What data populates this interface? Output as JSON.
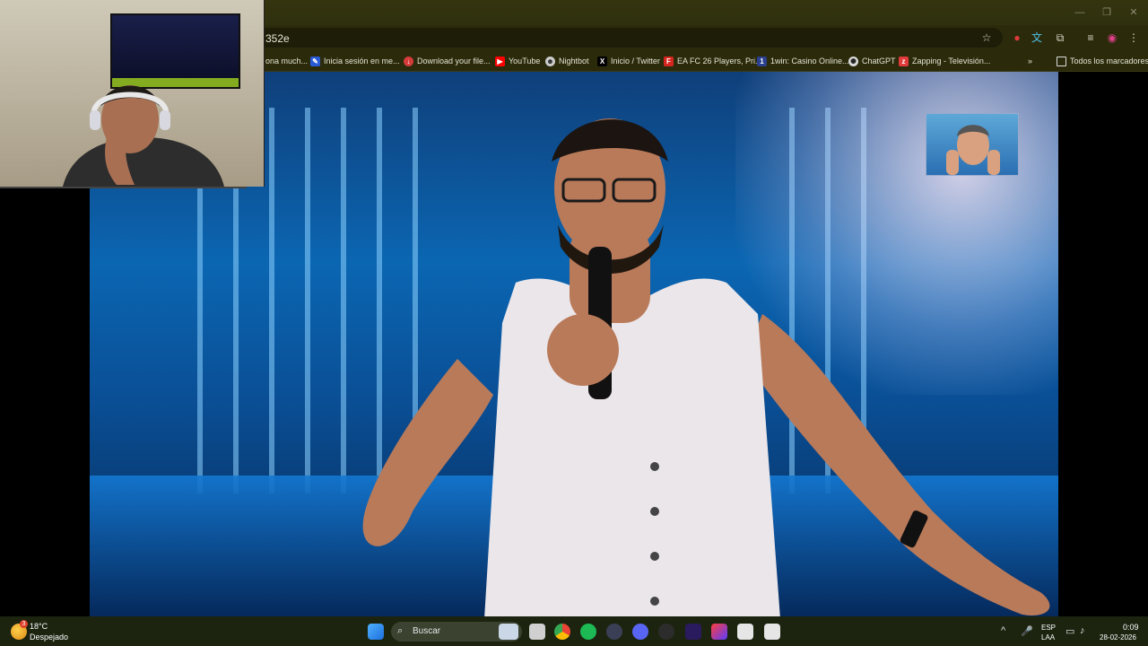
{
  "browser": {
    "url": "352e",
    "bookmarks": [
      {
        "label": "ona much...",
        "icon": "bookmark-icon",
        "color": "#444444"
      },
      {
        "label": "Inicia sesión en me...",
        "icon": "site-icon",
        "color": "#2a5bd7"
      },
      {
        "label": "Download your file...",
        "icon": "download-site-icon",
        "color": "#d63b3b"
      },
      {
        "label": "YouTube",
        "icon": "youtube-icon",
        "color": "#ff0000"
      },
      {
        "label": "Nightbot",
        "icon": "nightbot-icon",
        "color": "#cccccc"
      },
      {
        "label": "Inicio / Twitter",
        "icon": "x-twitter-icon",
        "color": "#000000"
      },
      {
        "label": "EA FC 26 Players, Pri...",
        "icon": "futbin-icon",
        "color": "#d6261f"
      },
      {
        "label": "1win: Casino Online...",
        "icon": "casino-icon",
        "color": "#2a3f8f"
      },
      {
        "label": "ChatGPT",
        "icon": "chatgpt-icon",
        "color": "#dddddd"
      },
      {
        "label": "Zapping - Televisión...",
        "icon": "zapping-icon",
        "color": "#e03a3a"
      }
    ],
    "all_bookmarks": "Todos los marcadores"
  },
  "taskbar": {
    "weather_badge": "3",
    "temperature": "18°C",
    "weather": "Despejado",
    "search": "Buscar",
    "lang_top": "ESP",
    "lang_bottom": "LAA",
    "time": "0:09",
    "date": "28-02-2026"
  }
}
